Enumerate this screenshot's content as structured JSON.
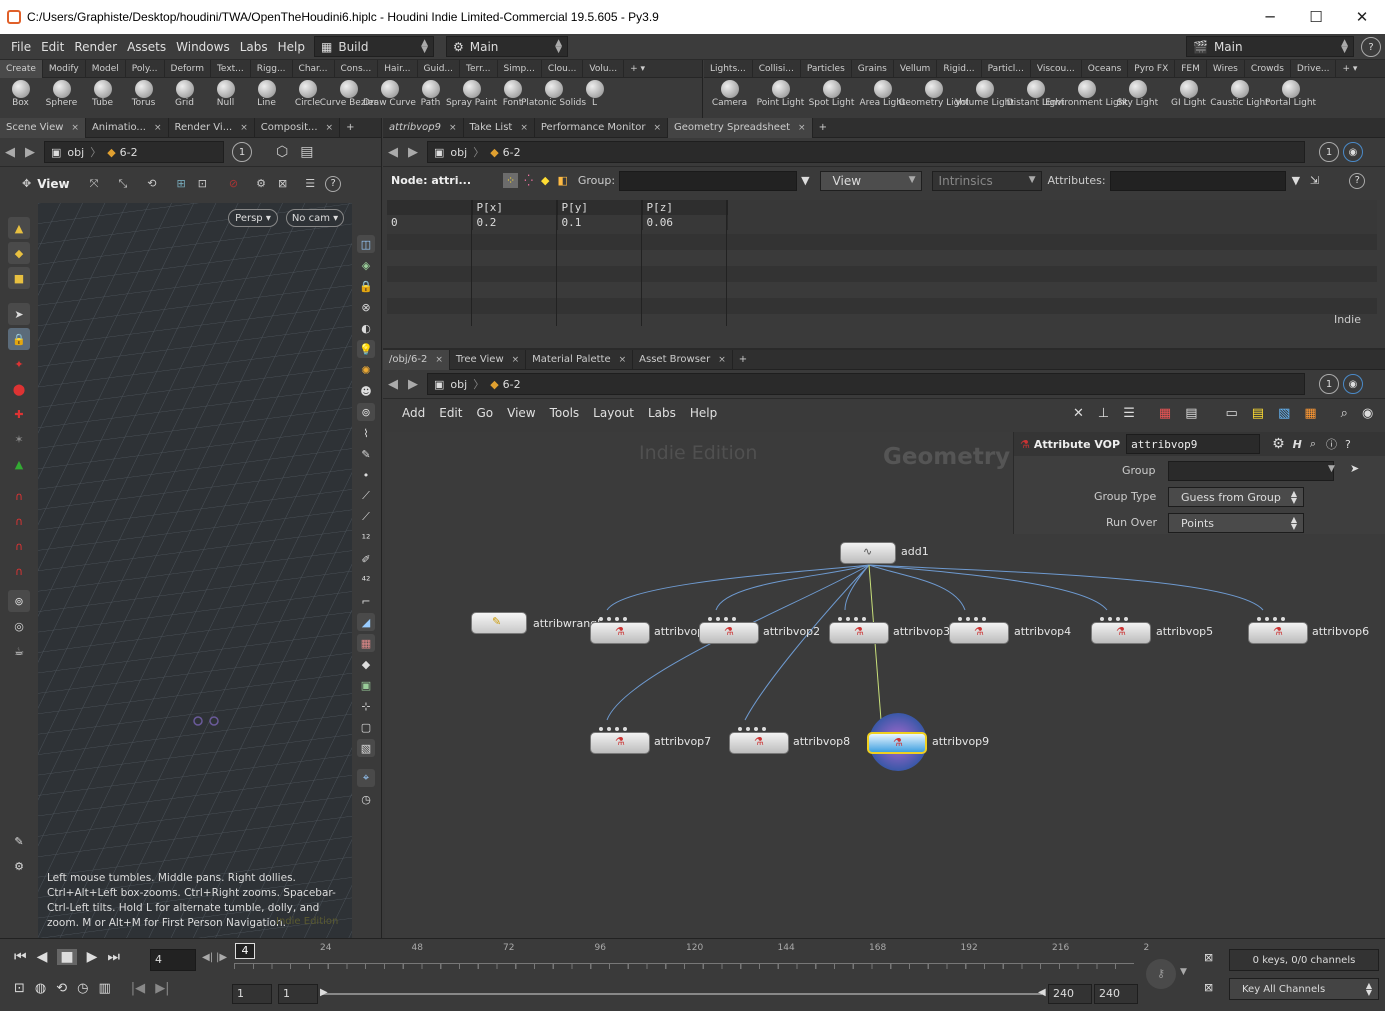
{
  "window": {
    "title": "C:/Users/Graphiste/Desktop/houdini/TWA/OpenTheHoudini6.hiplc - Houdini Indie Limited-Commercial 19.5.605 - Py3.9",
    "minimize": "─",
    "maximize": "☐",
    "close": "✕"
  },
  "menubar": {
    "items": [
      "File",
      "Edit",
      "Render",
      "Assets",
      "Windows",
      "Labs",
      "Help"
    ],
    "desktop_left": "Build",
    "desktop_mid": "Main",
    "desktop_right": "Main",
    "help_icon": "?"
  },
  "shelf_left": {
    "tabs": [
      "Create",
      "Modify",
      "Model",
      "Poly...",
      "Deform",
      "Text...",
      "Rigg...",
      "Char...",
      "Cons...",
      "Hair...",
      "Guid...",
      "Terr...",
      "Simp...",
      "Clou...",
      "Volu..."
    ],
    "tools": [
      "Box",
      "Sphere",
      "Tube",
      "Torus",
      "Grid",
      "Null",
      "Line",
      "Circle",
      "Curve Bezier",
      "Draw Curve",
      "Path",
      "Spray Paint",
      "Font",
      "Platonic Solids",
      "L"
    ]
  },
  "shelf_right": {
    "tabs": [
      "Lights...",
      "Collisi...",
      "Particles",
      "Grains",
      "Vellum",
      "Rigid...",
      "Particl...",
      "Viscou...",
      "Oceans",
      "Pyro FX",
      "FEM",
      "Wires",
      "Crowds",
      "Drive..."
    ],
    "tools": [
      "Camera",
      "Point Light",
      "Spot Light",
      "Area Light",
      "Geometry Light",
      "Volume Light",
      "Distant Light",
      "Environment Light",
      "Sky Light",
      "GI Light",
      "Caustic Light",
      "Portal Light"
    ]
  },
  "left_pane": {
    "tabs": [
      "Scene View",
      "Animatio...",
      "Render Vi...",
      "Composit..."
    ],
    "path_root": "obj",
    "path_node": "6-2",
    "circle": "1",
    "view_label": "View",
    "persp": "Persp",
    "cam": "No cam",
    "hint": "Left mouse tumbles. Middle pans. Right dollies. Ctrl+Alt+Left box-zooms. Ctrl+Right zooms. Spacebar-Ctrl-Left tilts. Hold L for alternate tumble, dolly, and zoom.    M or Alt+M for First Person Navigation.",
    "watermark": "Indie Edition"
  },
  "spreadsheet": {
    "tabs": [
      "attribvop9",
      "Take List",
      "Performance Monitor",
      "Geometry Spreadsheet"
    ],
    "path_root": "obj",
    "path_node": "6-2",
    "circle": "1",
    "node_label": "Node: attri...",
    "group_label": "Group:",
    "view_dd": "View",
    "intrinsics": "Intrinsics",
    "attributes_label": "Attributes:",
    "columns": [
      "",
      "P[x]",
      "P[y]",
      "P[z]"
    ],
    "rows": [
      [
        "0",
        "0.2",
        "0.1",
        "0.06"
      ]
    ],
    "indie": "Indie"
  },
  "network": {
    "tabs": [
      "/obj/6-2",
      "Tree View",
      "Material Palette",
      "Asset Browser"
    ],
    "path_root": "obj",
    "path_node": "6-2",
    "circle": "1",
    "menu": [
      "Add",
      "Edit",
      "Go",
      "View",
      "Tools",
      "Layout",
      "Labs",
      "Help"
    ],
    "watermark_indie": "Indie Edition",
    "watermark_ctx": "Geometry",
    "nodes": [
      "add1",
      "attribwrangl",
      "attribvop",
      "attribvop2",
      "attribvop3",
      "attribvop4",
      "attribvop5",
      "attribvop6",
      "attribvop7",
      "attribvop8",
      "attribvop9"
    ]
  },
  "params": {
    "type": "Attribute VOP",
    "name": "attribvop9",
    "group_label": "Group",
    "group_value": "",
    "group_type_label": "Group Type",
    "group_type_value": "Guess from Group",
    "run_over_label": "Run Over",
    "run_over_value": "Points"
  },
  "timeline": {
    "frame": "4",
    "marker": "4",
    "ticks": [
      "24",
      "48",
      "72",
      "96",
      "120",
      "144",
      "168",
      "192",
      "216",
      "2"
    ],
    "start1": "1",
    "start2": "1",
    "end1": "240",
    "end2": "240",
    "keys": "0 keys, 0/0 channels",
    "key_all": "Key All Channels"
  }
}
